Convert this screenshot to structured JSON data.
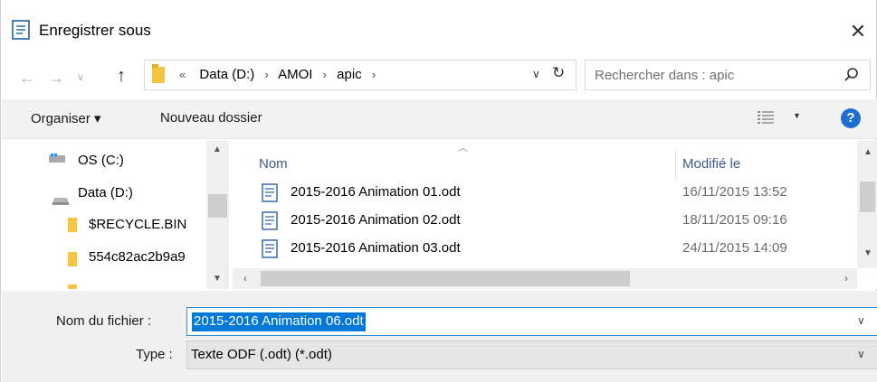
{
  "window": {
    "title": "Enregistrer sous",
    "close_icon": "close-icon"
  },
  "address": {
    "crumbs": [
      "Data (D:)",
      "AMOI",
      "apic"
    ],
    "overflow": "«",
    "search_placeholder": "Rechercher dans : apic"
  },
  "toolbar": {
    "organiser_label": "Organiser ▾",
    "new_folder_label": "Nouveau dossier",
    "help_label": "?"
  },
  "nav_pane": {
    "items": [
      {
        "label": "OS (C:)",
        "icon": "windows-drive-icon"
      },
      {
        "label": "Data (D:)",
        "icon": "drive-icon"
      },
      {
        "label": "$RECYCLE.BIN",
        "icon": "folder-icon"
      },
      {
        "label": "554c82ac2b9a9",
        "icon": "folder-icon"
      }
    ]
  },
  "file_list": {
    "columns": {
      "name": "Nom",
      "modified": "Modifié le"
    },
    "rows": [
      {
        "name": "2015-2016 Animation 01.odt",
        "modified": "16/11/2015 13:52"
      },
      {
        "name": "2015-2016 Animation 02.odt",
        "modified": "18/11/2015 09:16"
      },
      {
        "name": "2015-2016 Animation 03.odt",
        "modified": "24/11/2015 14:09"
      }
    ]
  },
  "form": {
    "filename_label": "Nom du fichier :",
    "filename_value": "2015-2016 Animation 06.odt",
    "type_label": "Type :",
    "type_value": "Texte ODF (.odt) (*.odt)"
  },
  "colors": {
    "accent": "#0078d7",
    "help": "#1c6fd1",
    "folder": "#f5c542",
    "header_text": "#3c5a88"
  }
}
